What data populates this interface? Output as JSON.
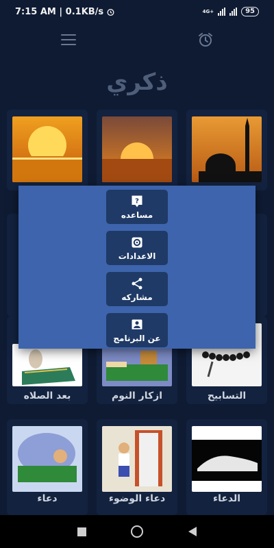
{
  "status": {
    "time": "7:15 AM | 0.1KB/s",
    "network": "4G+",
    "battery": "95"
  },
  "app": {
    "title": "ذكري"
  },
  "grid": {
    "cards": [
      {
        "label": "بعد الصلاه",
        "icon": "prayer-mat-image"
      },
      {
        "label": "ازكار النوم",
        "icon": "sleeping-image"
      },
      {
        "label": "التسابيح",
        "icon": "prayer-beads-image"
      },
      {
        "label": "دعاء",
        "icon": "sleeping-child-image"
      },
      {
        "label": "دعاء الوضوء",
        "icon": "bathroom-child-image"
      },
      {
        "label": "الدعاء",
        "icon": "shroud-image"
      }
    ],
    "top_row_icons": [
      "sunrise-image",
      "sunset-image",
      "mosque-image"
    ]
  },
  "menu": {
    "items": [
      {
        "label": "مساعده",
        "icon": "help-icon"
      },
      {
        "label": "الاعدادات",
        "icon": "settings-icon"
      },
      {
        "label": "مشاركه",
        "icon": "share-icon"
      },
      {
        "label": "عن البرنامج",
        "icon": "about-icon"
      }
    ]
  },
  "colors": {
    "background": "#0f1b33",
    "card": "#13223f",
    "dialog": "#3d64ad",
    "dialog_button": "#1f3a66"
  }
}
